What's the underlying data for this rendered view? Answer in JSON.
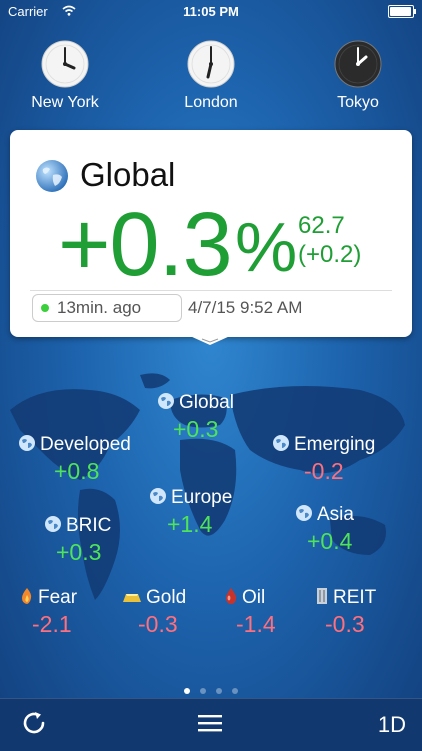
{
  "status_bar": {
    "carrier": "Carrier",
    "time": "11:05 PM"
  },
  "clocks": [
    {
      "city": "New York",
      "theme": "light"
    },
    {
      "city": "London",
      "theme": "light"
    },
    {
      "city": "Tokyo",
      "theme": "dark"
    }
  ],
  "card": {
    "title": "Global",
    "change_pct": "+0.3",
    "pct_symbol": "%",
    "value": "62.7",
    "value_change": "(+0.2)",
    "updated": "13min. ago",
    "timestamp": "4/7/15 9:52 AM"
  },
  "markets": {
    "global": {
      "name": "Global",
      "change": "+0.3"
    },
    "developed": {
      "name": "Developed",
      "change": "+0.8"
    },
    "emerging": {
      "name": "Emerging",
      "change": "-0.2"
    },
    "europe": {
      "name": "Europe",
      "change": "+1.4"
    },
    "bric": {
      "name": "BRIC",
      "change": "+0.3"
    },
    "asia": {
      "name": "Asia",
      "change": "+0.4"
    }
  },
  "commodities": {
    "fear": {
      "name": "Fear",
      "change": "-2.1"
    },
    "gold": {
      "name": "Gold",
      "change": "-0.3"
    },
    "oil": {
      "name": "Oil",
      "change": "-1.4"
    },
    "reit": {
      "name": "REIT",
      "change": "-0.3"
    }
  },
  "page_indicator": {
    "count": 4,
    "active": 0
  },
  "bottom_bar": {
    "range": "1D"
  },
  "colors": {
    "up": "#4fe35a",
    "down": "#ff6f7d",
    "card_green": "#1f9e35"
  }
}
